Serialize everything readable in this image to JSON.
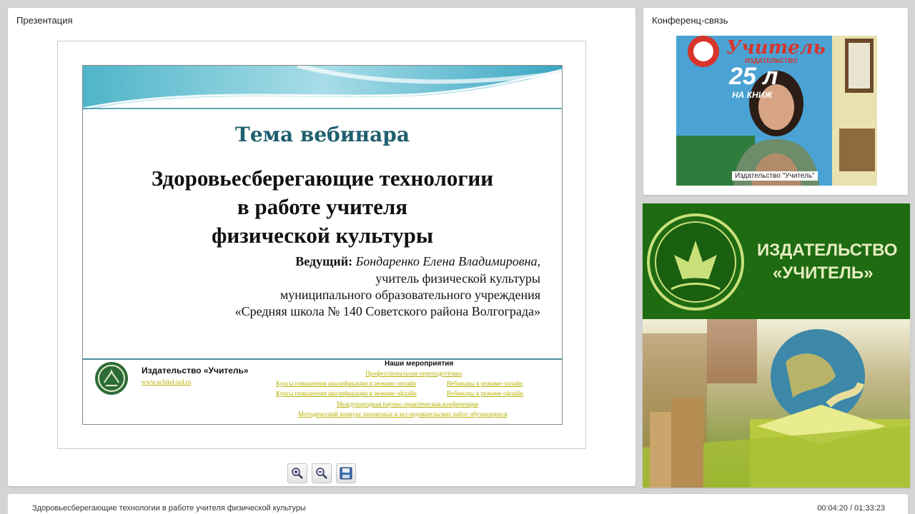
{
  "presentation": {
    "panel_title": "Презентация",
    "slide": {
      "title": "Тема вебинара",
      "heading_lines": [
        "Здоровьесберегающие технологии",
        "в работе учителя",
        "физической культуры"
      ],
      "presenter_label": "Ведущий:",
      "presenter_name": "Бондаренко Елена Владимировна,",
      "presenter_lines": [
        "учитель физической культуры",
        "муниципального образовательного учреждения",
        "«Средняя школа № 140 Советского района Волгограда»"
      ],
      "footer": {
        "publisher": "Издательство «Учитель»",
        "website": "www.uchitel-izd.ru",
        "events_title": "Наши мероприятия",
        "events_links": [
          "Профессиональная переподготовка",
          "Курсы повышения квалификации в режиме онлайн",
          "Вебинары в режиме онлайн",
          "Курсы повышения квалификации в режиме офлайн",
          "Вебинары в режиме офлайн",
          "Международная научно-практическая конференция",
          "Методический конкурс проектных и исследовательских работ обучающихся"
        ]
      }
    },
    "toolbar": [
      {
        "name": "zoom-in",
        "icon": "zoom-in-icon"
      },
      {
        "name": "zoom-out",
        "icon": "zoom-out-icon"
      },
      {
        "name": "save",
        "icon": "save-icon"
      }
    ]
  },
  "conference": {
    "panel_title": "Конференц-связь",
    "video_label": "Издательство \"Учитель\"",
    "background_text": {
      "brand": "Учитель",
      "brand_sub": "ИЗДАТЕЛЬСТВО",
      "years": "25 л",
      "years_sub": "НА КНИЖ"
    }
  },
  "banner": {
    "line1": "ИЗДАТЕЛЬСТВО",
    "line2": "«УЧИТЕЛЬ»",
    "colors": {
      "green": "#1e6b12",
      "accent": "#c9e07a"
    }
  },
  "status_bar": {
    "title": "Здоровьесберегающие технологии в работе учителя физической культуры",
    "time": "00:04:20 / 01:33:23"
  }
}
